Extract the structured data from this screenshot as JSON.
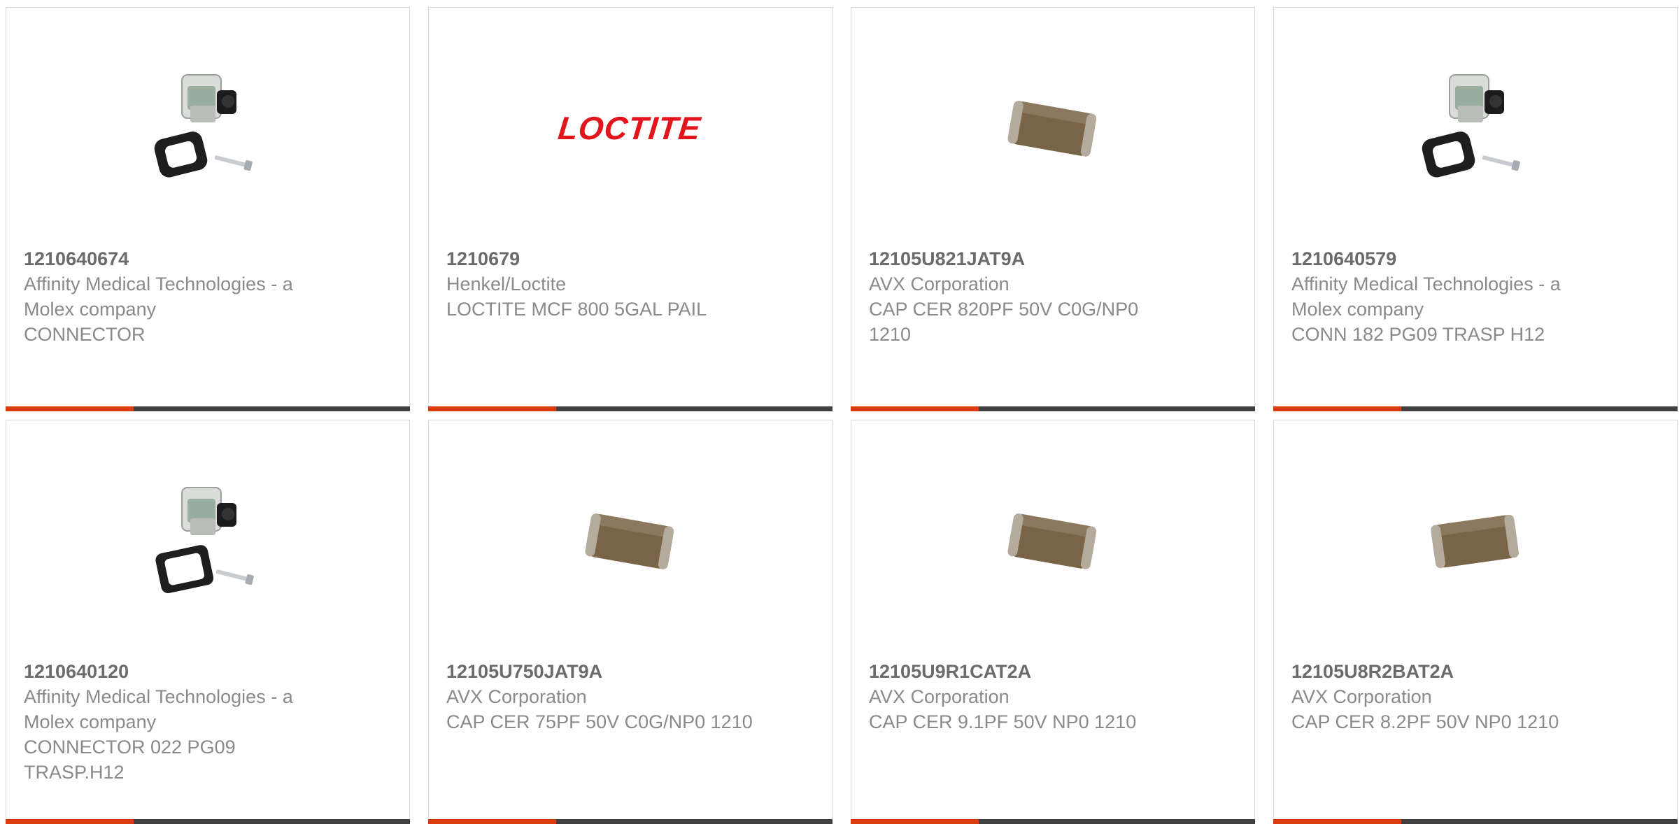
{
  "products": [
    {
      "part_number": "1210640674",
      "manufacturer": "Affinity Medical Technologies - a Molex company",
      "description": "CONNECTOR",
      "image": "connector-icon"
    },
    {
      "part_number": "1210679",
      "manufacturer": "Henkel/Loctite",
      "description": "LOCTITE MCF 800 5GAL PAIL",
      "image": "loctite-logo",
      "logo_text": "LOCTITE"
    },
    {
      "part_number": "12105U821JAT9A",
      "manufacturer": "AVX Corporation",
      "description": "CAP CER 820PF 50V C0G/NP0 1210",
      "image": "capacitor-icon"
    },
    {
      "part_number": "1210640579",
      "manufacturer": "Affinity Medical Technologies - a Molex company",
      "description": "CONN 182 PG09 TRASP H12",
      "image": "connector-icon"
    },
    {
      "part_number": "1210640120",
      "manufacturer": "Affinity Medical Technologies - a Molex company",
      "description": "CONNECTOR 022 PG09 TRASP.H12",
      "image": "connector-icon"
    },
    {
      "part_number": "12105U750JAT9A",
      "manufacturer": "AVX Corporation",
      "description": "CAP CER 75PF 50V C0G/NP0 1210",
      "image": "capacitor-icon"
    },
    {
      "part_number": "12105U9R1CAT2A",
      "manufacturer": "AVX Corporation",
      "description": "CAP CER 9.1PF 50V NP0 1210",
      "image": "capacitor-icon"
    },
    {
      "part_number": "12105U8R2BAT2A",
      "manufacturer": "AVX Corporation",
      "description": "CAP CER 8.2PF 50V NP0 1210",
      "image": "capacitor-icon"
    }
  ],
  "colors": {
    "accent": "#dc3a0f",
    "bar": "#404040",
    "text": "#8a8a8a",
    "part_number": "#6b6b6b",
    "brand_red": "#e2141c"
  }
}
